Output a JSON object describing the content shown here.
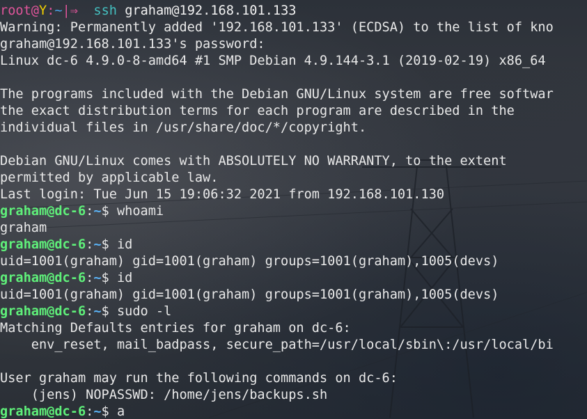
{
  "first_prompt": {
    "user": "root",
    "at": "@",
    "host": "Y",
    "colon": ":",
    "dir": "~",
    "bar": "|",
    "arrow": "⇒",
    "cmd_name": "ssh",
    "cmd_args": "graham@192.168.101.133"
  },
  "output_1": [
    "Warning: Permanently added '192.168.101.133' (ECDSA) to the list of kno",
    "graham@192.168.101.133's password:",
    "Linux dc-6 4.9.0-8-amd64 #1 SMP Debian 4.9.144-3.1 (2019-02-19) x86_64",
    "",
    "The programs included with the Debian GNU/Linux system are free softwar",
    "the exact distribution terms for each program are described in the",
    "individual files in /usr/share/doc/*/copyright.",
    "",
    "Debian GNU/Linux comes with ABSOLUTELY NO WARRANTY, to the extent",
    "permitted by applicable law.",
    "Last login: Tue Jun 15 19:06:32 2021 from 192.168.101.130"
  ],
  "prompt": {
    "user_host": "graham@dc-6",
    "colon": ":",
    "dir": "~",
    "symbol": "$"
  },
  "session": [
    {
      "command": "whoami",
      "output": [
        "graham"
      ]
    },
    {
      "command": "id",
      "output": [
        "uid=1001(graham) gid=1001(graham) groups=1001(graham),1005(devs)"
      ]
    },
    {
      "command": "id",
      "output": [
        "uid=1001(graham) gid=1001(graham) groups=1001(graham),1005(devs)"
      ]
    },
    {
      "command": "sudo -l",
      "output": [
        "Matching Defaults entries for graham on dc-6:",
        "    env_reset, mail_badpass, secure_path=/usr/local/sbin\\:/usr/local/bi",
        "",
        "User graham may run the following commands on dc-6:",
        "    (jens) NOPASSWD: /home/jens/backups.sh"
      ]
    },
    {
      "command": "a",
      "output": []
    }
  ],
  "colors": {
    "prompt_user": "#5ff07a",
    "prompt_path": "#5ab2f5",
    "root_user": "#e0559b",
    "host_y": "#f3d000",
    "ssh_cmd": "#44c0c0"
  }
}
